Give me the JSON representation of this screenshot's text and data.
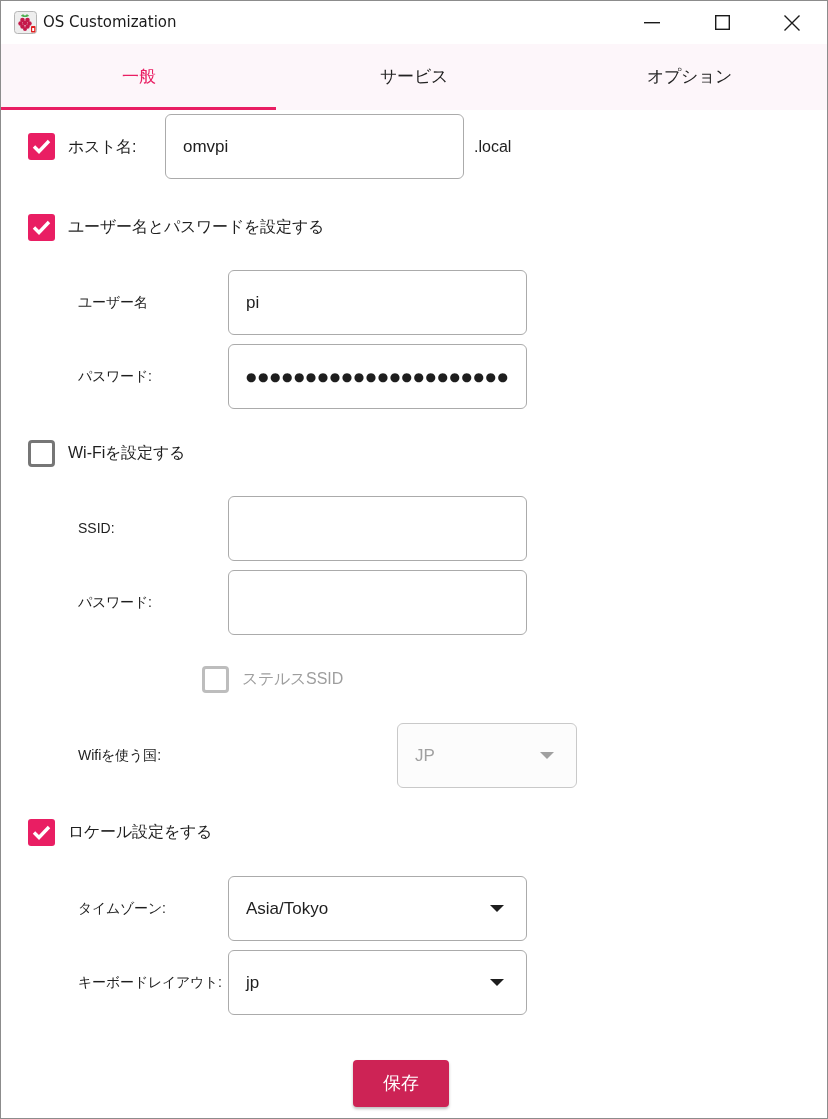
{
  "window": {
    "title": "OS Customization"
  },
  "tabs": [
    {
      "label": "一般",
      "selected": true
    },
    {
      "label": "サービス",
      "selected": false
    },
    {
      "label": "オプション",
      "selected": false
    }
  ],
  "items": [
    {
      "kind": "hostname",
      "label": "ホスト名:",
      "checked": true,
      "disabled": false,
      "value": "omvpi",
      "suffix": ".local"
    },
    {
      "kind": "checkbox",
      "label": "ユーザー名とパスワードを設定する",
      "checked": true,
      "disabled": false
    },
    {
      "kind": "text",
      "label": "ユーザー名",
      "value": "pi",
      "disabled": false
    },
    {
      "kind": "password",
      "label": "パスワード:",
      "value": "●●●●●●●●●●●●●●●●●●●●●●",
      "disabled": false
    },
    {
      "kind": "checkbox",
      "label": "Wi-Fiを設定する",
      "checked": false,
      "disabled": false
    },
    {
      "kind": "text",
      "label": "SSID:",
      "disabled": false
    },
    {
      "kind": "password",
      "label": "パスワード:",
      "disabled": false
    },
    {
      "kind": "subcheckbox",
      "label": "ステルスSSID",
      "checked": false,
      "disabled": true
    },
    {
      "kind": "smalldropdown",
      "label": "Wifiを使う国:",
      "value": "JP",
      "disabled": true
    },
    {
      "kind": "checkbox",
      "label": "ロケール設定をする",
      "checked": true,
      "disabled": false
    },
    {
      "kind": "dropdown",
      "label": "タイムゾーン:",
      "value": "Asia/Tokyo",
      "disabled": false
    },
    {
      "kind": "dropdown",
      "label": "キーボードレイアウト:",
      "value": "jp",
      "disabled": false
    }
  ],
  "save_button": "保存"
}
